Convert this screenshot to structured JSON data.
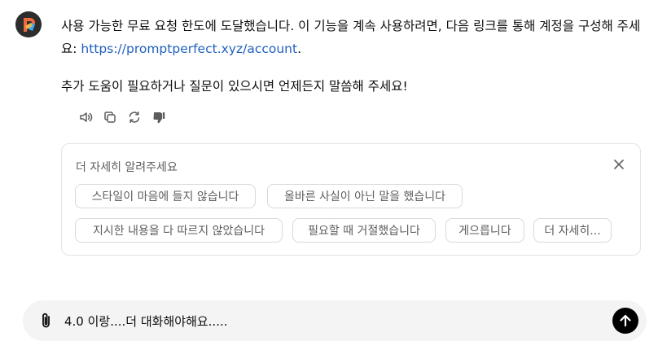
{
  "message": {
    "part1": "사용 가능한 무료 요청 한도에 도달했습니다. 이 기능을 계속 사용하려면, 다음 링크를 통해 계정을 구성해 주세요: ",
    "link": "https://promptperfect.xyz/account",
    "part1_end": ".",
    "part2": "추가 도움이 필요하거나 질문이 있으시면 언제든지 말씀해 주세요!"
  },
  "actions": [
    "read-aloud-icon",
    "copy-icon",
    "regenerate-icon",
    "thumbs-down-icon"
  ],
  "feedback": {
    "title": "더 자세히 알려주세요",
    "chips": [
      "스타일이 마음에 들지 않습니다",
      "올바른 사실이 아닌 말을 했습니다",
      "지시한 내용을 다 따르지 않았습니다",
      "필요할 때 거절했습니다",
      "게으릅니다",
      "더 자세히..."
    ]
  },
  "composer": {
    "value": "4.0 이랑....더 대화해야해요....."
  }
}
